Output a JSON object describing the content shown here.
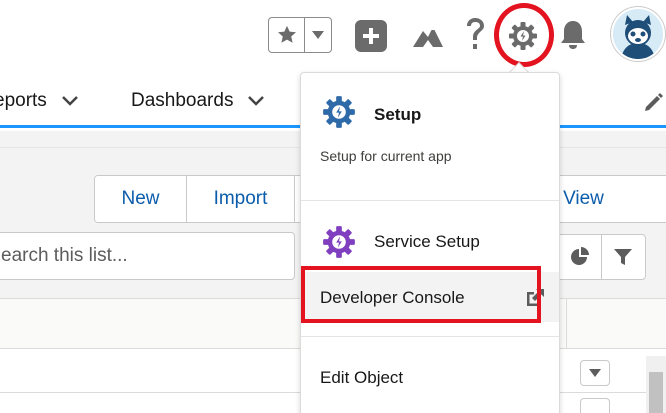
{
  "nav": {
    "items": [
      {
        "label": "eports"
      },
      {
        "label": "Dashboards"
      }
    ]
  },
  "list": {
    "buttons": {
      "new": "New",
      "import": "Import",
      "printable": "le View"
    },
    "search": {
      "placeholder": "earch this list..."
    }
  },
  "setup_menu": {
    "setup_title": "Setup",
    "setup_subtitle": "Setup for current app",
    "service_setup": "Service Setup",
    "developer_console": "Developer Console",
    "edit_object": "Edit Object"
  },
  "colors": {
    "brand_blue": "#1b96ff",
    "link_blue": "#0b5cab",
    "setup_gear": "#2f6aa8",
    "service_gear": "#7f3fbf",
    "highlight_red": "#e3141f"
  },
  "icons": {
    "favorites": "star-icon",
    "favorites_menu": "caret-down-icon",
    "global_actions": "plus-icon",
    "trailhead": "mountain-icon",
    "help": "question-icon",
    "setup": "gear-icon",
    "notifications": "bell-icon",
    "user": "avatar",
    "edit_nav": "pencil-icon",
    "list_chart": "pie-chart-icon",
    "list_filter": "filter-icon",
    "external_link": "external-link-icon"
  }
}
